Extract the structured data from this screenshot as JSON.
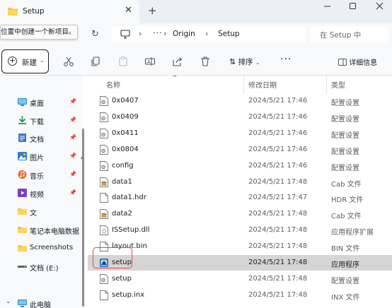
{
  "window": {
    "tab_title": "Setup",
    "tooltip": "位置中创建一个新项目。"
  },
  "address": {
    "crumbs": [
      "Origin",
      "Setup"
    ],
    "ellipsis": "···",
    "search_placeholder": "在 Setup 中"
  },
  "toolbar": {
    "new_label": "新建",
    "sort_label": "排序",
    "more_label": "···",
    "details_label": "详细信息"
  },
  "sidebar": {
    "items": [
      {
        "label": "桌面",
        "icon": "desktop-icon",
        "pinned": true
      },
      {
        "label": "下载",
        "icon": "download-icon",
        "pinned": true
      },
      {
        "label": "文档",
        "icon": "documents-icon",
        "pinned": true
      },
      {
        "label": "图片",
        "icon": "pictures-icon",
        "pinned": true
      },
      {
        "label": "音乐",
        "icon": "music-icon",
        "pinned": true
      },
      {
        "label": "视频",
        "icon": "video-icon",
        "pinned": true
      },
      {
        "label": "文",
        "icon": "folder-icon",
        "pinned": false
      },
      {
        "label": "笔记本电脑数据",
        "icon": "folder-icon",
        "pinned": false
      },
      {
        "label": "Screenshots",
        "icon": "folder-icon",
        "pinned": false
      },
      {
        "label": "文档 (E:)",
        "icon": "drive-icon",
        "pinned": false
      },
      {
        "label": "此电脑",
        "icon": "pc-icon",
        "pinned": false
      }
    ]
  },
  "columns": {
    "name": "名称",
    "date": "修改日期",
    "type": "类型"
  },
  "files": [
    {
      "name": "0x0407",
      "date": "2024/5/21 17:46",
      "type": "配置设置",
      "icon": "config-file-icon"
    },
    {
      "name": "0x0409",
      "date": "2024/5/21 17:46",
      "type": "配置设置",
      "icon": "config-file-icon"
    },
    {
      "name": "0x0411",
      "date": "2024/5/21 17:46",
      "type": "配置设置",
      "icon": "config-file-icon"
    },
    {
      "name": "0x0804",
      "date": "2024/5/21 17:46",
      "type": "配置设置",
      "icon": "config-file-icon"
    },
    {
      "name": "config",
      "date": "2024/5/21 17:46",
      "type": "配置设置",
      "icon": "config-file-icon"
    },
    {
      "name": "data1",
      "date": "2024/5/21 17:48",
      "type": "Cab 文件",
      "icon": "cab-file-icon"
    },
    {
      "name": "data1.hdr",
      "date": "2024/5/21 17:47",
      "type": "HDR 文件",
      "icon": "blank-file-icon"
    },
    {
      "name": "data2",
      "date": "2024/5/21 17:48",
      "type": "Cab 文件",
      "icon": "cab-file-icon"
    },
    {
      "name": "ISSetup.dll",
      "date": "2024/5/21 17:48",
      "type": "应用程序扩展",
      "icon": "dll-file-icon"
    },
    {
      "name": "layout.bin",
      "date": "2024/5/21 17:48",
      "type": "BIN 文件",
      "icon": "blank-file-icon"
    },
    {
      "name": "setup",
      "date": "2024/5/21 17:48",
      "type": "应用程序",
      "icon": "setup-exe-icon",
      "selected": true
    },
    {
      "name": "setup",
      "date": "2024/5/21 17:48",
      "type": "配置设置",
      "icon": "config-file-icon"
    },
    {
      "name": "setup.inx",
      "date": "2024/5/21 17:48",
      "type": "INX 文件",
      "icon": "blank-file-icon"
    }
  ],
  "colors": {
    "accent": "#0067c0",
    "highlight_border": "#e04a4a",
    "selection": "#d5d5d5"
  }
}
